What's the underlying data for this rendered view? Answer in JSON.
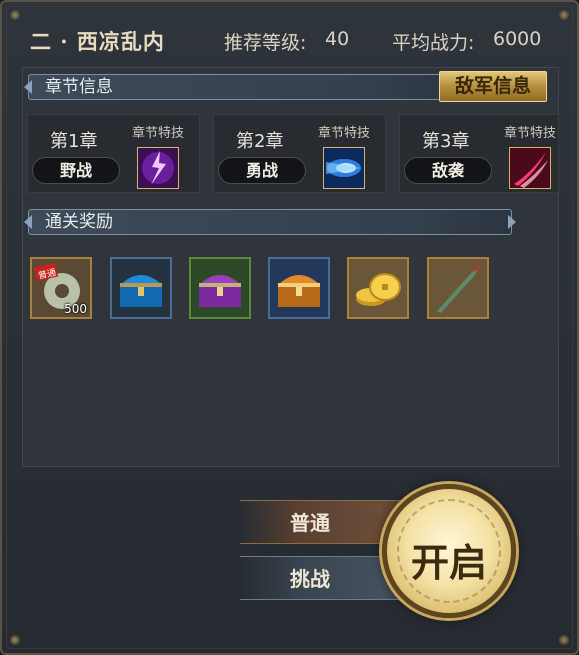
{
  "header": {
    "title": "二 · 西凉乱内",
    "level_label": "推荐等级:",
    "level_value": "40",
    "power_label": "平均战力:",
    "power_value": "6000"
  },
  "chapter_section": {
    "title": "章节信息",
    "enemy_info_label": "敌军信息"
  },
  "chapters": [
    {
      "title": "第1章",
      "skill_label": "章节特技",
      "battle_type": "野战",
      "skill_icon": "purple-lightning-icon"
    },
    {
      "title": "第2章",
      "skill_label": "章节特技",
      "battle_type": "勇战",
      "skill_icon": "blue-energy-icon"
    },
    {
      "title": "第3章",
      "skill_label": "章节特技",
      "battle_type": "敌袭",
      "skill_icon": "red-slash-icon"
    }
  ],
  "reward_section": {
    "title": "通关奖励"
  },
  "rewards": [
    {
      "icon": "jade-token-icon",
      "badge": "普通",
      "qty": "500"
    },
    {
      "icon": "blue-chest-icon"
    },
    {
      "icon": "purple-chest-icon"
    },
    {
      "icon": "orange-chest-icon"
    },
    {
      "icon": "gold-coins-icon"
    },
    {
      "icon": "green-blade-icon"
    }
  ],
  "modes": {
    "normal_label": "普通",
    "challenge_label": "挑战"
  },
  "start_label": "开启"
}
